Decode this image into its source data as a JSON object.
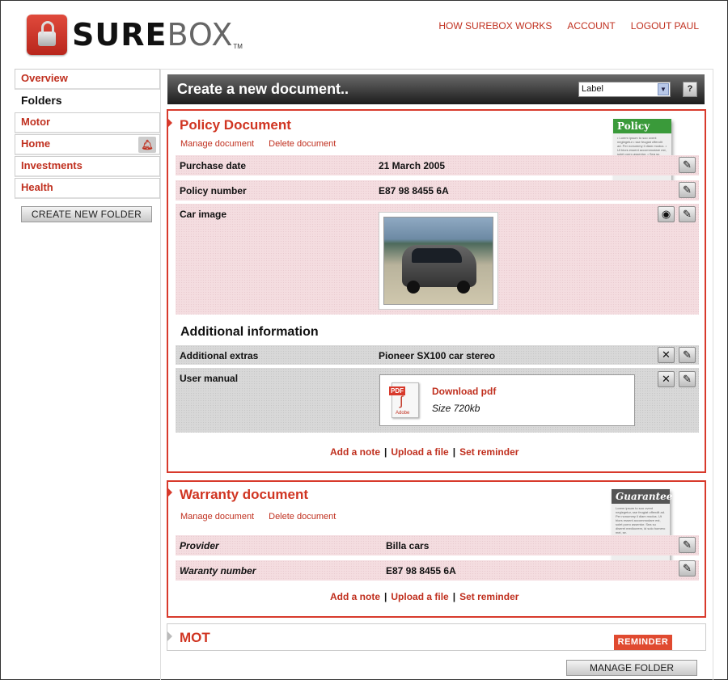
{
  "brand": {
    "name_bold": "SURE",
    "name_light": "BOX",
    "tm": "TM"
  },
  "topnav": {
    "how": "HOW SUREBOX WORKS",
    "account": "ACCOUNT",
    "logout": "LOGOUT PAUL"
  },
  "sidebar": {
    "overview": "Overview",
    "folders": "Folders",
    "items": [
      "Motor",
      "Home",
      "Investments",
      "Health"
    ],
    "create_button": "CREATE NEW FOLDER"
  },
  "titlebar": {
    "title": "Create a new document..",
    "select_value": "Label",
    "help": "?"
  },
  "policy": {
    "title": "Policy Document",
    "manage": "Manage document",
    "delete": "Delete document",
    "thumb_title": "Policy",
    "thumb_text": "• Lorem ipsum to soo ovent neglegetur • sse feugiat cffendit ad. Per nonummy il diam modus. • Ut biors essent accommodare est, solet porro assentor. • Sea su diseret mediocrem, id solo homero.",
    "fields": [
      {
        "label": "Purchase date",
        "value": "21 March 2005"
      },
      {
        "label": "Policy number",
        "value": "E87 98 8455 6A"
      },
      {
        "label": "Car image",
        "value": ""
      }
    ],
    "additional_heading": "Additional information",
    "extras": [
      {
        "label": "Additional extras",
        "value": "Pioneer SX100 car stereo"
      },
      {
        "label": "User manual",
        "value": ""
      }
    ],
    "pdf": {
      "tag": "PDF",
      "brand": "Adobe",
      "link": "Download pdf",
      "size": "Size 720kb"
    },
    "actions": {
      "note": "Add a note",
      "upload": "Upload a file",
      "reminder": "Set reminder",
      "sep": "|"
    }
  },
  "warranty": {
    "title": "Warranty document",
    "manage": "Manage document",
    "delete": "Delete document",
    "thumb_title": "Guarantee",
    "thumb_text": "Lorem ipsum to soo ovent neglegetur, sse feugiat offendit ad. Per nonummy il diam modus. Ut biors essent accommodare est, solet porro assentor. Sea su diseret mediocrem, id solo homero mei, se.",
    "fields": [
      {
        "label": "Provider",
        "value": "Billa cars"
      },
      {
        "label": "Waranty number",
        "value": "E87 98 8455 6A"
      }
    ],
    "actions": {
      "note": "Add a note",
      "upload": "Upload a file",
      "reminder": "Set reminder",
      "sep": "|"
    }
  },
  "mot": {
    "title": "MOT",
    "reminder": "REMINDER"
  },
  "manage_folder": "MANAGE FOLDER",
  "colors": {
    "accent": "#d83a2c",
    "pink_row": "#f4dde0",
    "grey_row": "#d8d8d8",
    "policy_green": "#3a9a3a",
    "guarantee_grey": "#555555"
  },
  "icons": {
    "edit": "pencil-icon",
    "view": "eye-icon",
    "remove": "close-icon",
    "alert": "bell-icon",
    "lock": "padlock-icon"
  }
}
